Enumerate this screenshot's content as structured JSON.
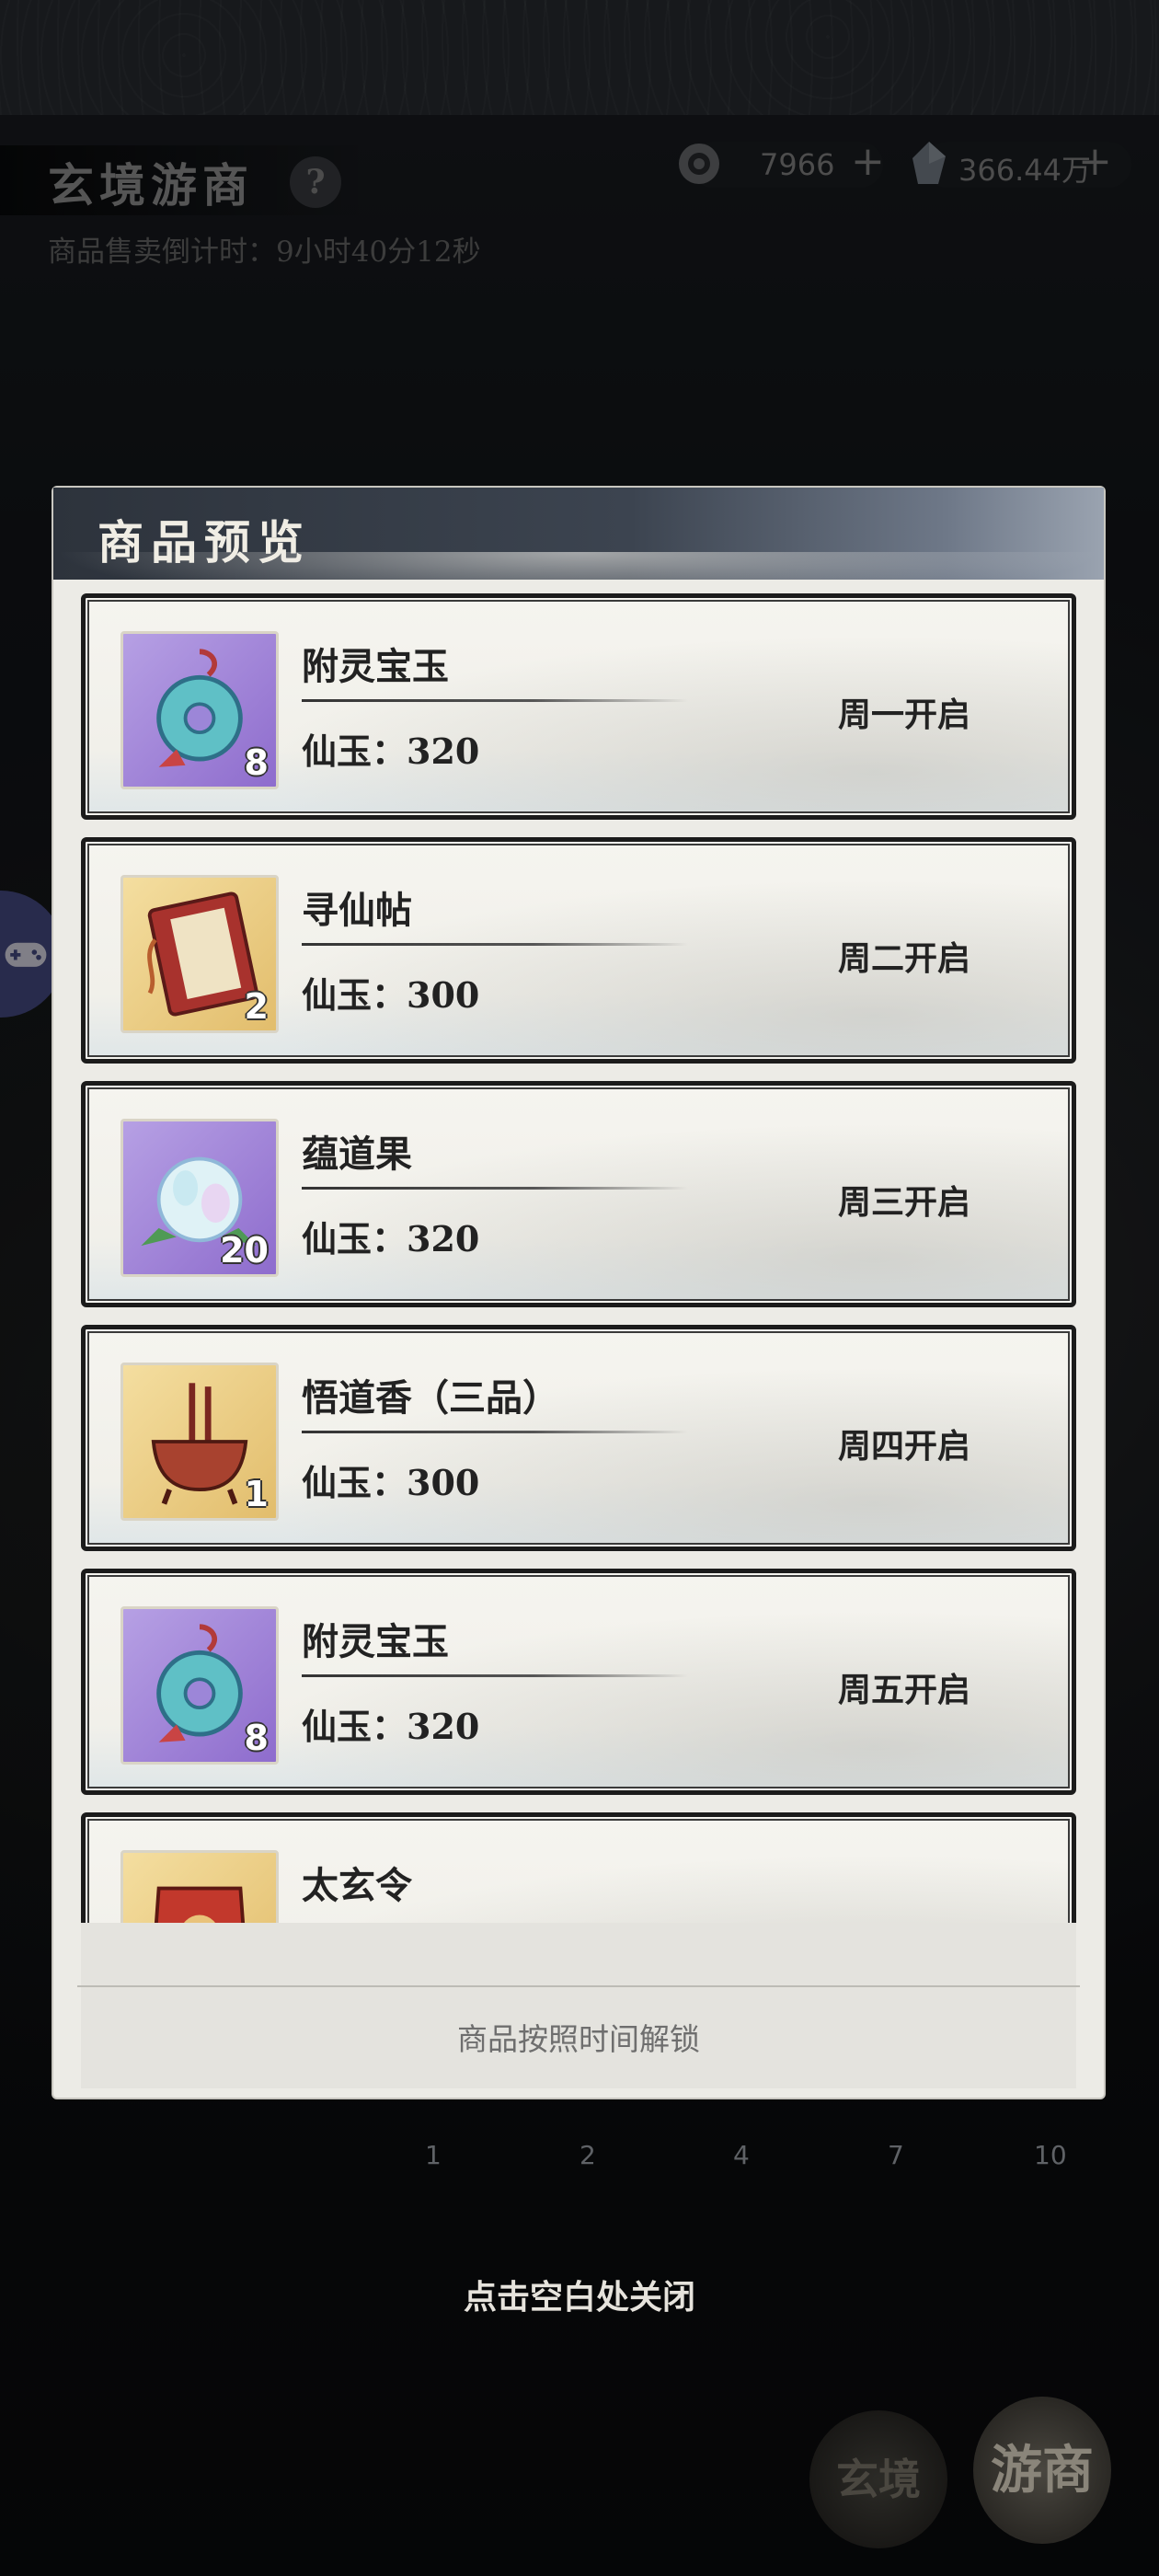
{
  "header": {
    "title": "玄境游商",
    "help_icon": "?",
    "countdown": "商品售卖倒计时：9小时40分12秒"
  },
  "currency": [
    {
      "icon": "coin-icon",
      "value": "7966"
    },
    {
      "icon": "jade-crystal-icon",
      "value": "366.44万"
    }
  ],
  "modal": {
    "title": "商品预览",
    "items": [
      {
        "name": "附灵宝玉",
        "price": "仙玉：320",
        "unlock": "周一开启",
        "qty": "8",
        "icon": "jade-pendant-icon",
        "rarity": "purple"
      },
      {
        "name": "寻仙帖",
        "price": "仙玉：300",
        "unlock": "周二开启",
        "qty": "2",
        "icon": "scroll-book-icon",
        "rarity": "gold"
      },
      {
        "name": "蕴道果",
        "price": "仙玉：320",
        "unlock": "周三开启",
        "qty": "20",
        "icon": "spirit-fruit-icon",
        "rarity": "purple"
      },
      {
        "name": "悟道香（三品）",
        "price": "仙玉：300",
        "unlock": "周四开启",
        "qty": "1",
        "icon": "incense-burner-icon",
        "rarity": "gold"
      },
      {
        "name": "附灵宝玉",
        "price": "仙玉：320",
        "unlock": "周五开启",
        "qty": "8",
        "icon": "jade-pendant-icon",
        "rarity": "purple"
      },
      {
        "name": "太玄令",
        "price": "",
        "unlock": "",
        "qty": "",
        "icon": "token-icon",
        "rarity": "gold"
      }
    ],
    "footer_note": "商品按照时间解锁"
  },
  "progress_labels": [
    "1",
    "2",
    "4",
    "7",
    "10"
  ],
  "close_hint": "点击空白处关闭",
  "bottom_tabs": [
    "玄境",
    "游商"
  ]
}
